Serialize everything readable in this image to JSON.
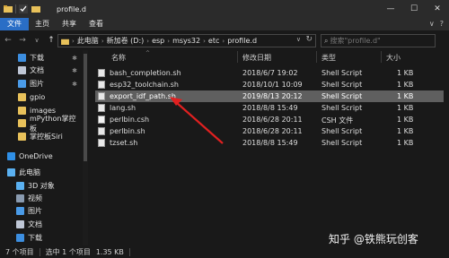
{
  "window": {
    "title": "profile.d",
    "controls": [
      "—",
      "☐",
      "✕"
    ]
  },
  "ribbon": {
    "tabs": [
      "文件",
      "主页",
      "共享",
      "查看"
    ],
    "right": [
      "∨",
      "?"
    ]
  },
  "addressbar": {
    "crumbs": [
      "此电脑",
      "新加卷 (D:)",
      "esp",
      "msys32",
      "etc",
      "profile.d"
    ],
    "search_placeholder": "搜索\"profile.d\""
  },
  "sidebar": {
    "items": [
      {
        "label": "下载",
        "icon": "download-icon",
        "color": "#3c8ee0",
        "pinned": true
      },
      {
        "label": "文档",
        "icon": "document-icon",
        "color": "#bfc7d6",
        "pinned": true
      },
      {
        "label": "图片",
        "icon": "picture-icon",
        "color": "#4a9be8",
        "pinned": true
      },
      {
        "label": "gpio",
        "icon": "folder-icon",
        "color": "#e8c15a",
        "pinned": false
      },
      {
        "label": "images",
        "icon": "folder-icon",
        "color": "#e8c15a",
        "pinned": false
      },
      {
        "label": "mPython掌控板",
        "icon": "folder-icon",
        "color": "#e8c15a",
        "pinned": false
      },
      {
        "label": "掌控板Siri",
        "icon": "folder-icon",
        "color": "#e8c15a",
        "pinned": false
      },
      {
        "label": "OneDrive",
        "icon": "onedrive-icon",
        "color": "#2f8fe6",
        "pinned": false
      },
      {
        "label": "此电脑",
        "icon": "computer-icon",
        "color": "#5ab0f0",
        "pinned": false
      },
      {
        "label": "3D 对象",
        "icon": "3d-objects-icon",
        "color": "#5ab0f0",
        "pinned": false
      },
      {
        "label": "视频",
        "icon": "video-icon",
        "color": "#8a9bb0",
        "pinned": false
      },
      {
        "label": "图片",
        "icon": "picture-icon",
        "color": "#4a9be8",
        "pinned": false
      },
      {
        "label": "文档",
        "icon": "document-icon",
        "color": "#bfc7d6",
        "pinned": false
      },
      {
        "label": "下载",
        "icon": "download-icon",
        "color": "#3c8ee0",
        "pinned": false
      }
    ]
  },
  "columns": {
    "name": "名称",
    "modified": "修改日期",
    "type": "类型",
    "size": "大小"
  },
  "files": [
    {
      "name": "bash_completion.sh",
      "modified": "2018/6/7 19:02",
      "type": "Shell Script",
      "size": "1 KB",
      "selected": false,
      "icon": "script-file-icon"
    },
    {
      "name": "esp32_toolchain.sh",
      "modified": "2018/10/1 10:09",
      "type": "Shell Script",
      "size": "1 KB",
      "selected": false,
      "icon": "script-file-icon"
    },
    {
      "name": "export_idf_path.sh",
      "modified": "2019/8/13 20:12",
      "type": "Shell Script",
      "size": "1 KB",
      "selected": true,
      "icon": "script-file-icon"
    },
    {
      "name": "lang.sh",
      "modified": "2018/8/8 15:49",
      "type": "Shell Script",
      "size": "1 KB",
      "selected": false,
      "icon": "script-file-icon"
    },
    {
      "name": "perlbin.csh",
      "modified": "2018/6/28 20:11",
      "type": "CSH 文件",
      "size": "1 KB",
      "selected": false,
      "icon": "csh-file-icon"
    },
    {
      "name": "perlbin.sh",
      "modified": "2018/6/28 20:11",
      "type": "Shell Script",
      "size": "1 KB",
      "selected": false,
      "icon": "script-file-icon"
    },
    {
      "name": "tzset.sh",
      "modified": "2018/8/8 15:49",
      "type": "Shell Script",
      "size": "1 KB",
      "selected": false,
      "icon": "script-file-icon"
    }
  ],
  "status": {
    "items": "7 个项目",
    "selection": "选中 1 个项目",
    "size": "1.35 KB"
  },
  "watermark": "知乎 @铁熊玩创客",
  "colors": {
    "accent": "#2a6ec6",
    "selection": "#5f5f5f",
    "annotation_arrow": "#e02020"
  }
}
